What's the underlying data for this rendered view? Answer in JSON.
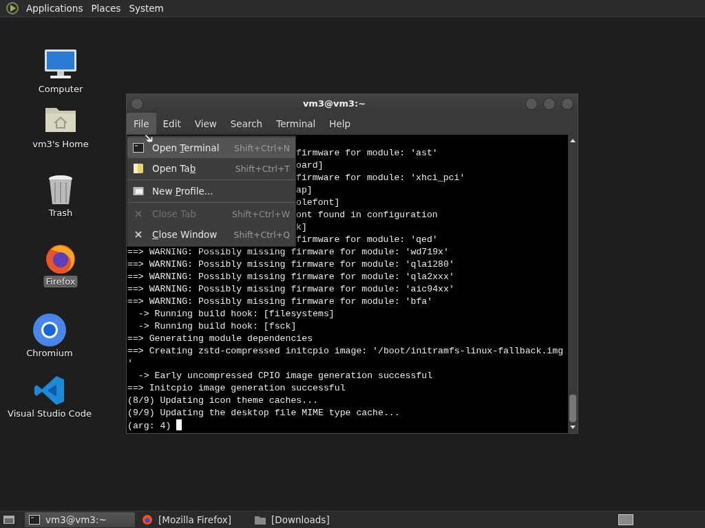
{
  "top_panel": {
    "menus": [
      "Applications",
      "Places",
      "System"
    ]
  },
  "desktop_icons": [
    {
      "kind": "computer",
      "label": "Computer",
      "selected": false
    },
    {
      "kind": "home",
      "label": "vm3's Home",
      "selected": false
    },
    {
      "kind": "trash",
      "label": "Trash",
      "selected": false
    },
    {
      "kind": "firefox",
      "label": "Firefox",
      "selected": true
    },
    {
      "kind": "chromium",
      "label": "Chromium",
      "selected": false
    },
    {
      "kind": "vscode",
      "label": "Visual Studio Code",
      "selected": false
    }
  ],
  "window": {
    "title": "vm3@vm3:~",
    "menubar": [
      {
        "label": "File",
        "selected": true
      },
      {
        "label": "Edit",
        "selected": false
      },
      {
        "label": "View",
        "selected": false
      },
      {
        "label": "Search",
        "selected": false
      },
      {
        "label": "Terminal",
        "selected": false
      },
      {
        "label": "Help",
        "selected": false
      }
    ],
    "file_menu": [
      {
        "kind": "item",
        "parts": [
          {
            "text": "Open ",
            "underlined": false
          },
          {
            "text": "T",
            "underlined": true
          },
          {
            "text": "erminal",
            "underlined": false
          }
        ],
        "shortcut": "Shift+Ctrl+N",
        "selected": true,
        "disabled": false
      },
      {
        "kind": "item",
        "parts": [
          {
            "text": "Open Ta",
            "underlined": false
          },
          {
            "text": "b",
            "underlined": true
          }
        ],
        "shortcut": "Shift+Ctrl+T",
        "selected": false,
        "disabled": false
      },
      {
        "kind": "separator"
      },
      {
        "kind": "item",
        "parts": [
          {
            "text": "New ",
            "underlined": false
          },
          {
            "text": "P",
            "underlined": true
          },
          {
            "text": "rofile...",
            "underlined": false
          }
        ],
        "selected": false,
        "disabled": false
      },
      {
        "kind": "separator"
      },
      {
        "kind": "item",
        "parts": [
          {
            "text": "Close Tab",
            "underlined": false
          }
        ],
        "shortcut": "Shift+Ctrl+W",
        "selected": false,
        "disabled": true
      },
      {
        "kind": "item",
        "parts": [
          {
            "text": "C",
            "underlined": true
          },
          {
            "text": "lose Window",
            "underlined": false
          }
        ],
        "shortcut": "Shift+Ctrl+Q",
        "selected": false,
        "disabled": false
      }
    ],
    "terminal_lines": [
      {
        "text": "firmware for module: 'ast'",
        "covered": true
      },
      {
        "text": "oard]",
        "covered": true
      },
      {
        "text": "firmware for module: 'xhci_pci'",
        "covered": true
      },
      {
        "text": "ap]",
        "covered": true
      },
      {
        "text": "olefont]",
        "covered": true
      },
      {
        "text": "ont found in configuration",
        "covered": true
      },
      {
        "text": "k]",
        "covered": true
      },
      {
        "text": "firmware for module: 'qed'",
        "covered": true
      },
      {
        "text": "==> WARNING: Possibly missing firmware for module: 'wd719x'",
        "covered": false
      },
      {
        "text": "==> WARNING: Possibly missing firmware for module: 'qla1280'",
        "covered": false
      },
      {
        "text": "==> WARNING: Possibly missing firmware for module: 'qla2xxx'",
        "covered": false
      },
      {
        "text": "==> WARNING: Possibly missing firmware for module: 'aic94xx'",
        "covered": false
      },
      {
        "text": "==> WARNING: Possibly missing firmware for module: 'bfa'",
        "covered": false
      },
      {
        "text": "  -> Running build hook: [filesystems]",
        "covered": false
      },
      {
        "text": "  -> Running build hook: [fsck]",
        "covered": false
      },
      {
        "text": "==> Generating module dependencies",
        "covered": false
      },
      {
        "text": "==> Creating zstd-compressed initcpio image: '/boot/initramfs-linux-fallback.img",
        "covered": false
      },
      {
        "text": "'",
        "covered": false
      },
      {
        "text": "  -> Early uncompressed CPIO image generation successful",
        "covered": false
      },
      {
        "text": "==> Initcpio image generation successful",
        "covered": false
      },
      {
        "text": "(8/9) Updating icon theme caches...",
        "covered": false
      },
      {
        "text": "(9/9) Updating the desktop file MIME type cache...",
        "covered": false
      },
      {
        "text": "(arg: 4) ",
        "covered": false,
        "cursor": true
      }
    ]
  },
  "taskbar": {
    "tasks": [
      {
        "label": "vm3@vm3:~",
        "selected": true
      },
      {
        "label": "[Mozilla Firefox]",
        "selected": false
      },
      {
        "label": "[Downloads]",
        "selected": false
      }
    ]
  }
}
